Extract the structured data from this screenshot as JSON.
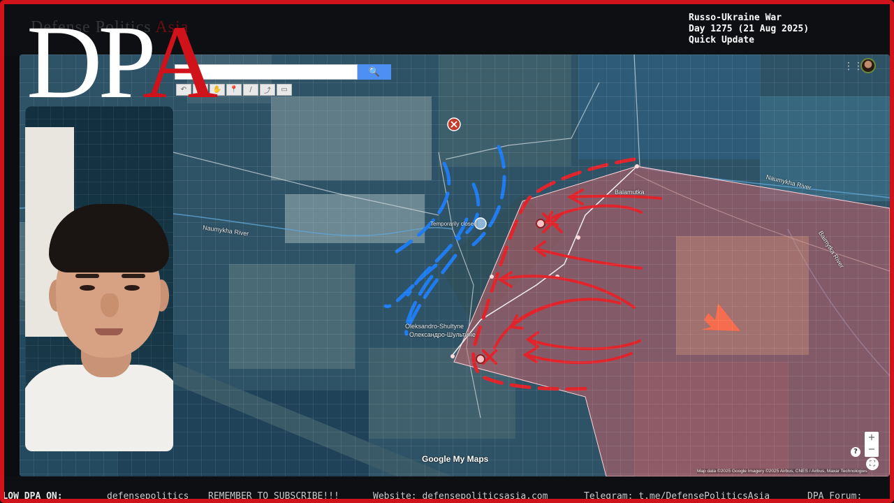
{
  "colors": {
    "frame_red": "#d0121b",
    "russian_red": "#e0242c",
    "ukraine_blue": "#1e7cf0",
    "occupied_fill": "#c9626a"
  },
  "logo": {
    "ghost_text_a": "Defense Politics",
    "ghost_text_b": "Asia",
    "main_dp": "DP",
    "main_a": "A"
  },
  "info": {
    "line1": "Russo-Ukraine War",
    "line2": "Day 1275 (21 Aug 2025)",
    "line3": "Quick Update"
  },
  "map": {
    "search_icon": "search-icon",
    "search_glyph": "🔍",
    "toolbar_icons": [
      "undo-icon",
      "redo-icon",
      "pan-hand-icon",
      "marker-icon",
      "line-icon",
      "route-icon",
      "ruler-icon"
    ],
    "toolbar_glyphs": [
      "↶",
      "↷",
      "✋",
      "📍",
      "∕",
      "⤴",
      "▭"
    ],
    "labels": {
      "river_west": "Naumykha River",
      "river_ne": "Naumykha River",
      "river_se": "Baimytka River",
      "village": "Balamutka",
      "town_latin": "Oleksandro-Shultyne",
      "town_cyrillic": "Олександро-Шультине",
      "temporarily_closed": "Temporarily closed"
    },
    "google_logo": "Google My Maps",
    "credit": "Map data ©2025 Google Imagery ©2025 Airbus, CNES / Airbus, Maxar Technologies",
    "zoom_in": "+",
    "zoom_out": "−",
    "help": "?",
    "fullscreen_glyph": "⛶"
  },
  "ticker": {
    "item1": "FOLLOW DPA ON:",
    "item2": "defensepolitics",
    "item3": "REMEMBER TO SUBSCRIBE!!!",
    "item4": "Website: defensepoliticsasia.com",
    "item5": "Telegram: t.me/DefensePoliticsAsia",
    "item6": "DPA Forum:"
  }
}
